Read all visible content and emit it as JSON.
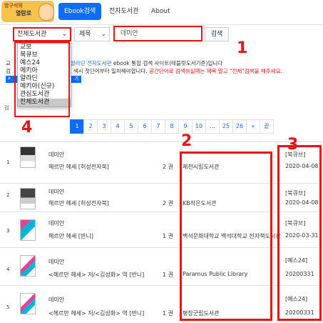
{
  "header": {
    "logo_line1": "방구석의",
    "logo_line2": "열람로",
    "nav": [
      {
        "label": "Ebook검색",
        "active": true
      },
      {
        "label": "전자도서관",
        "active": false
      },
      {
        "label": "About",
        "active": false
      }
    ]
  },
  "search": {
    "library_select": "전체도서관",
    "field_select": "제목",
    "query": "데미안",
    "button": "검색"
  },
  "library_options": [
    "교보",
    "북큐브",
    "예스24",
    "메키아",
    "알라딘",
    "메키아(신규)",
    "관심도서관",
    "전체도서관"
  ],
  "selected_option": "전체도서관",
  "info": {
    "line1_pre": "교",
    "line1_link": "알라딘 전자도서관",
    "line1_post": " ebook 통합 검색 사이트(테블릿도서기준)입니다",
    "line2_pre": "검",
    "line2_mid": "색시 첫단어부터 일치해야합니다. ",
    "line2_red": "공간단어로 검색하실때는 제목 말고 \"전체\"검색을 해주세요.",
    "button_prefix": "ㅍ",
    "button_suffix": "기"
  },
  "result_count_label": "검",
  "badges": [
    "1",
    "2",
    "3",
    "4"
  ],
  "pagination": [
    "1",
    "2",
    "3",
    "4",
    "5",
    "6",
    "7",
    "8",
    "9",
    "10",
    "...",
    "25",
    "26",
    "»",
    "끝"
  ],
  "results": [
    {
      "num": "1",
      "author": "데미안",
      "title": "헤르만 헤세 [허성전자북]",
      "qty": "2 권",
      "library": "제천시립도서관",
      "store": "[북큐브]",
      "date": "2020-04-08"
    },
    {
      "num": "2",
      "author": "데미안",
      "title": "헤르만 헤세 [허성전자북]",
      "qty": "2 권",
      "library": "KB작은도서관",
      "store": "[북큐브]",
      "date": "2020-04-08"
    },
    {
      "num": "3",
      "author": "데미안",
      "title": "헤르만 헤세 [반니]",
      "qty": "1 권",
      "library": "백석문화대학교 백석대학교 전자책도서관",
      "store": "[북큐브]",
      "date": "2020-03-31"
    },
    {
      "num": "4",
      "author": "데미안",
      "title": "<헤르만 헤세> 저/<김성화> 역 [반니]",
      "qty": "1 권",
      "library": "Paramus Public Library",
      "store": "[예스24]",
      "date": "20200331"
    },
    {
      "num": "5",
      "author": "데미안",
      "title": "<헤르만 헤세> 저/<김성화> 역 [반니]",
      "qty": "1 권",
      "library": "평창군립도서관",
      "store": "[예스24]",
      "date": "20200331"
    }
  ],
  "colors": {
    "accent": "#0d6efd",
    "annotation": "#ee1111"
  }
}
